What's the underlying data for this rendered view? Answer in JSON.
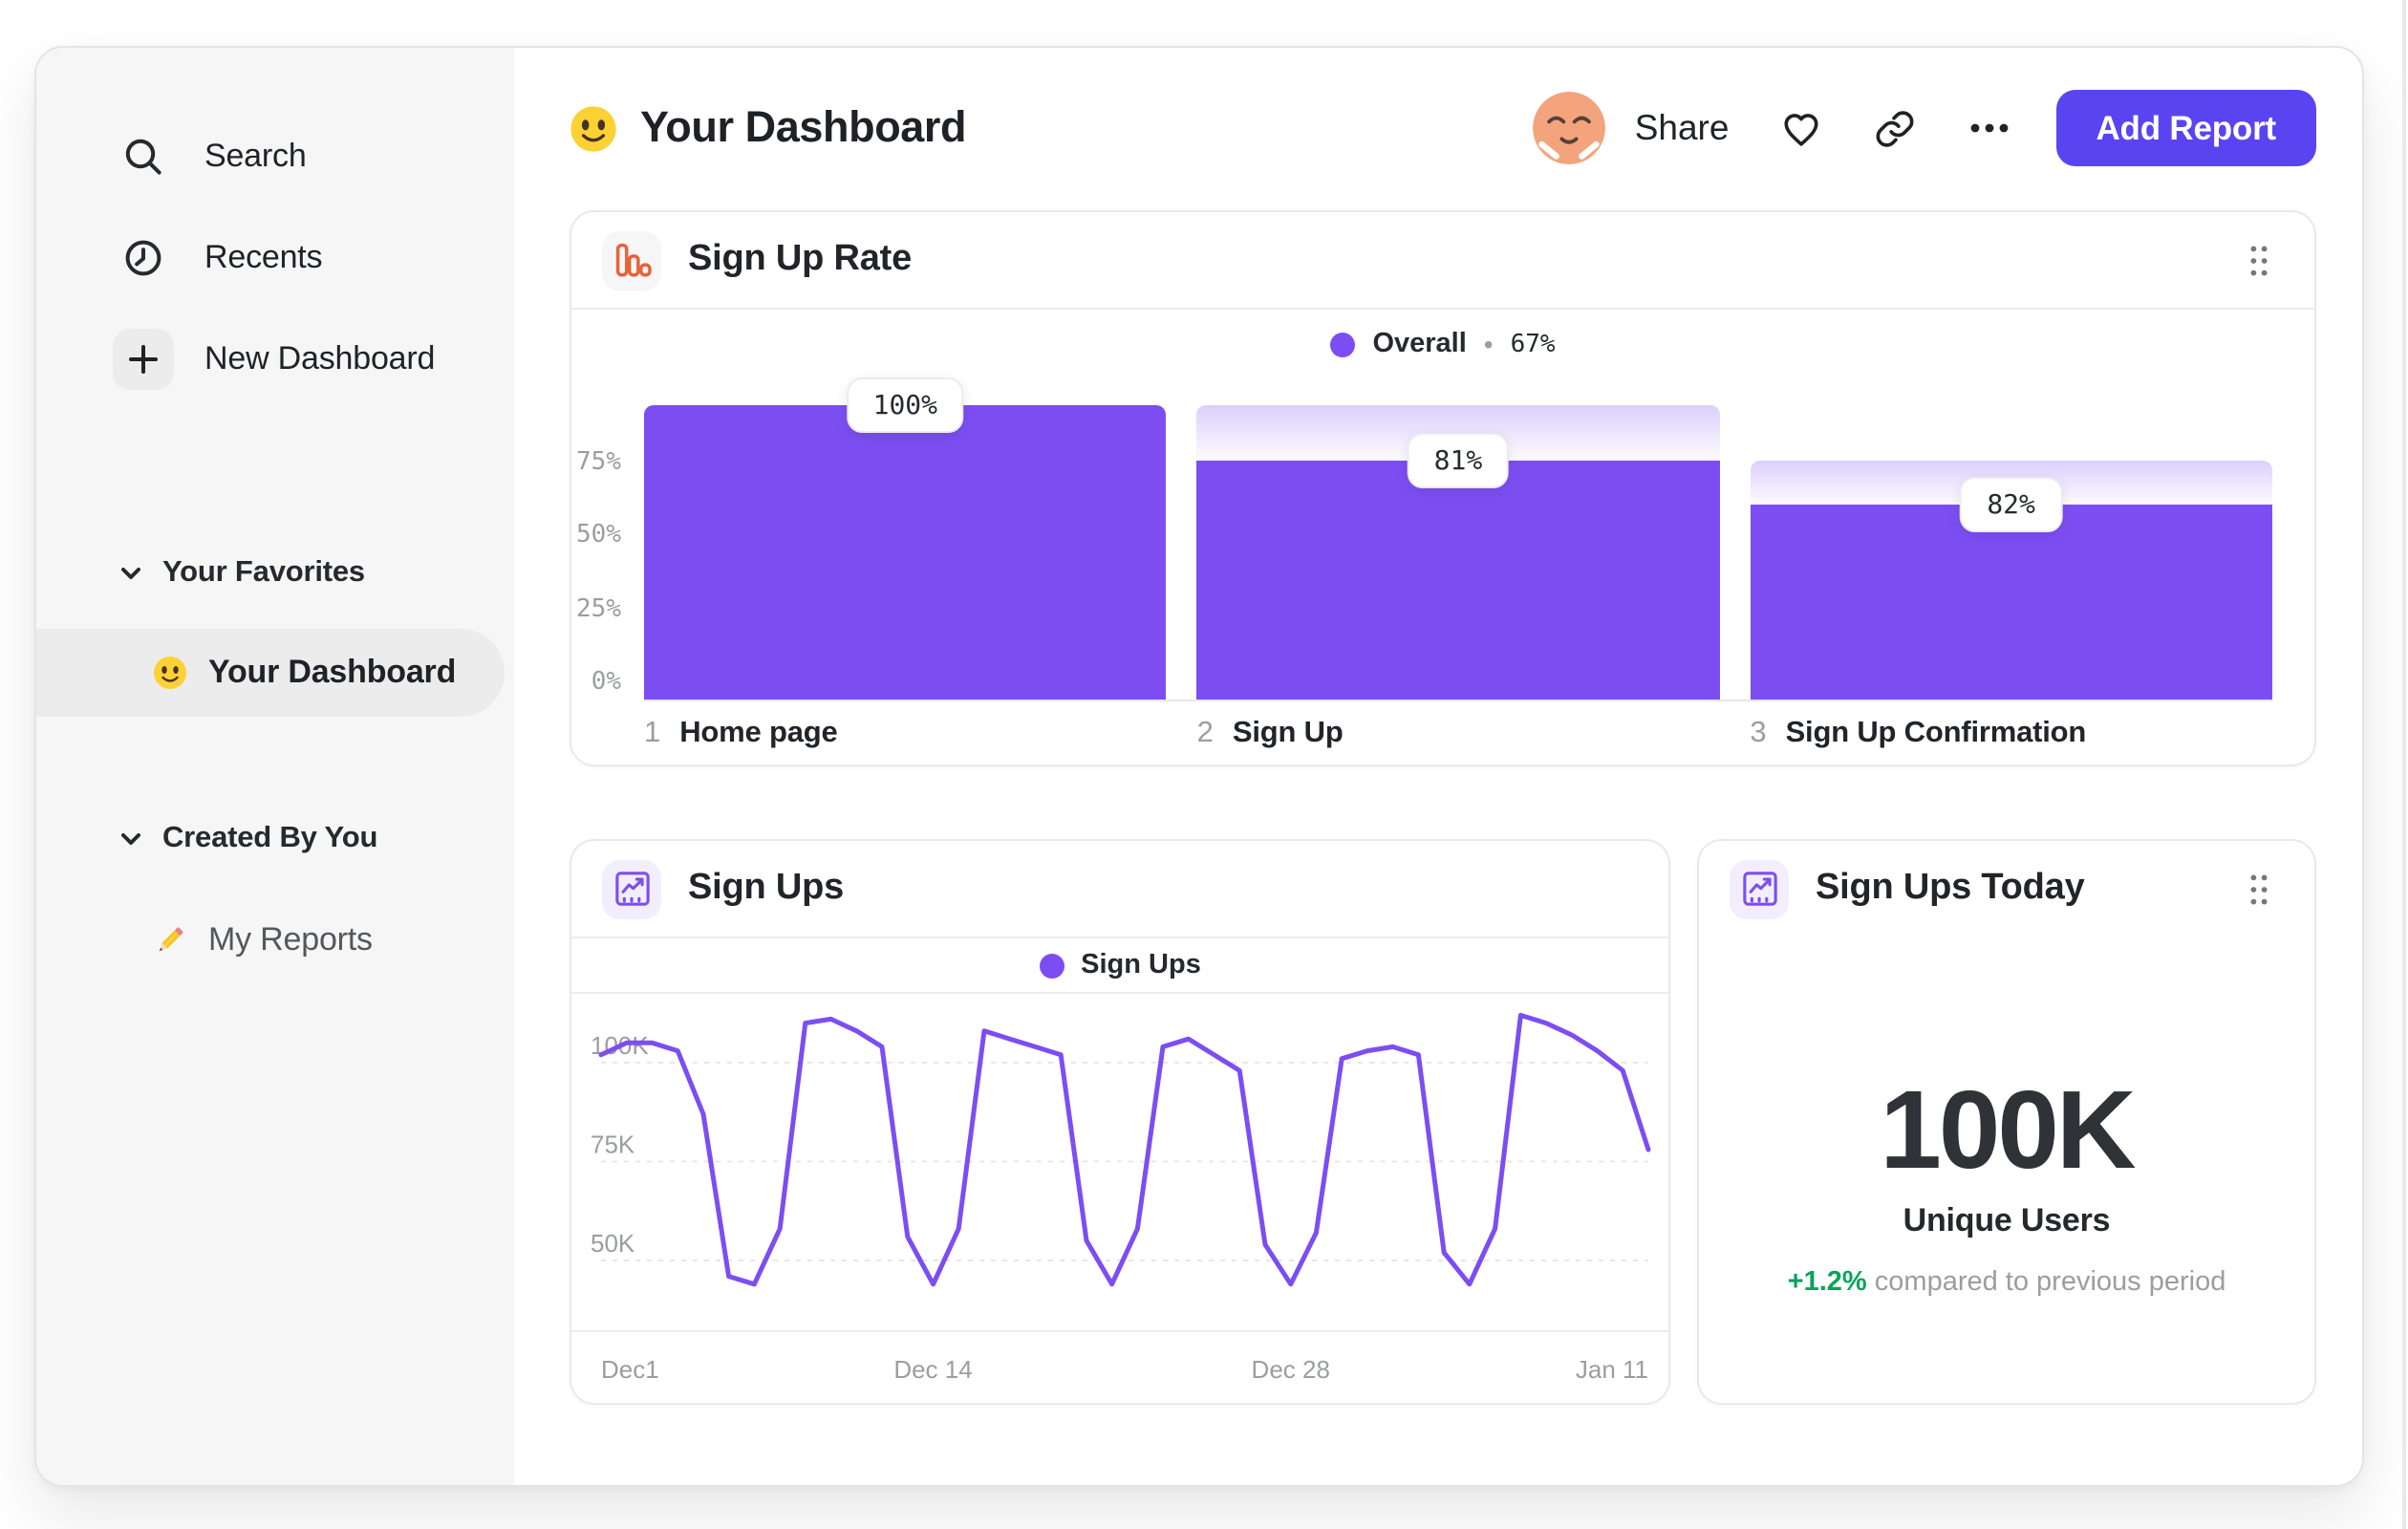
{
  "sidebar": {
    "nav": [
      {
        "label": "Search"
      },
      {
        "label": "Recents"
      },
      {
        "label": "New Dashboard"
      }
    ],
    "sections": [
      {
        "title": "Your Favorites",
        "items": [
          {
            "label": "Your Dashboard"
          }
        ]
      },
      {
        "title": "Created By You",
        "items": [
          {
            "label": "My Reports"
          }
        ]
      }
    ]
  },
  "header": {
    "title": "Your Dashboard",
    "share_label": "Share",
    "add_report_label": "Add Report"
  },
  "colors": {
    "accent_purple": "#7c4ef2",
    "button_purple": "#5a44f2",
    "icon_orange": "#e8623a",
    "positive_green": "#0ba35c"
  },
  "chart_data": [
    {
      "type": "bar",
      "subtype": "funnel",
      "title": "Sign Up Rate",
      "legend": {
        "series": "Overall",
        "sep": "•",
        "value": "67%"
      },
      "categories": [
        "Home page",
        "Sign Up",
        "Sign Up Confirmation"
      ],
      "step_numbers": [
        "1",
        "2",
        "3"
      ],
      "values": [
        100,
        81,
        66
      ],
      "prev_values": [
        100,
        100,
        81
      ],
      "value_labels": [
        "100%",
        "81%",
        "82%"
      ],
      "yticks": [
        75,
        50,
        25,
        0
      ],
      "ytick_labels": [
        "75%",
        "50%",
        "25%",
        "0%"
      ],
      "ylim": [
        0,
        100
      ]
    },
    {
      "type": "line",
      "title": "Sign Ups",
      "legend": {
        "series": "Sign Ups"
      },
      "unit": "K",
      "x_tick_labels": [
        "Dec1",
        "Dec 14",
        "Dec 28",
        "Jan 11"
      ],
      "x_tick_days": [
        0,
        13,
        27,
        41
      ],
      "yticks": [
        100,
        75,
        50
      ],
      "ytick_labels": [
        "100K",
        "75K",
        "50K"
      ],
      "ylim": [
        30,
        118
      ],
      "values": [
        102,
        105,
        105,
        103,
        87,
        46,
        44,
        58,
        110,
        111,
        108,
        104,
        56,
        44,
        58,
        108,
        106,
        104,
        102,
        55,
        44,
        58,
        104,
        106,
        102,
        98,
        54,
        44,
        57,
        101,
        103,
        104,
        102,
        52,
        44,
        58,
        112,
        110,
        107,
        103,
        98,
        78
      ]
    },
    {
      "type": "number",
      "title": "Sign Ups Today",
      "value": "100K",
      "label": "Unique Users",
      "delta": "+1.2%",
      "delta_note": "compared to previous period"
    }
  ]
}
